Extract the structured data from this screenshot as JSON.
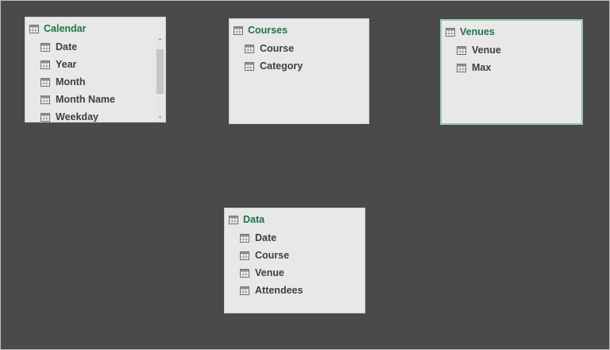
{
  "diagram": {
    "tables": [
      {
        "name": "Calendar",
        "icon": "table-icon",
        "fields": [
          {
            "label": "Date",
            "icon": "field-icon"
          },
          {
            "label": "Year",
            "icon": "field-icon"
          },
          {
            "label": "Month",
            "icon": "field-icon"
          },
          {
            "label": "Month Name",
            "icon": "field-icon"
          },
          {
            "label": "Weekday",
            "icon": "field-icon"
          }
        ],
        "has_scrollbar": true
      },
      {
        "name": "Courses",
        "icon": "table-icon",
        "fields": [
          {
            "label": "Course",
            "icon": "field-icon"
          },
          {
            "label": "Category",
            "icon": "field-icon"
          }
        ]
      },
      {
        "name": "Venues",
        "icon": "table-icon",
        "selected": true,
        "fields": [
          {
            "label": "Venue",
            "icon": "field-icon"
          },
          {
            "label": "Max",
            "icon": "field-icon"
          }
        ]
      },
      {
        "name": "Data",
        "icon": "table-icon",
        "fields": [
          {
            "label": "Date",
            "icon": "field-icon"
          },
          {
            "label": "Course",
            "icon": "field-icon"
          },
          {
            "label": "Venue",
            "icon": "field-icon"
          },
          {
            "label": "Attendees",
            "icon": "field-icon"
          }
        ]
      }
    ]
  },
  "colors": {
    "canvas_bg": "#4a4a4a",
    "card_bg": "#e8e8e8",
    "title_green": "#217346",
    "selected_border": "#8fc6a4",
    "field_text": "#3f3f3f"
  }
}
